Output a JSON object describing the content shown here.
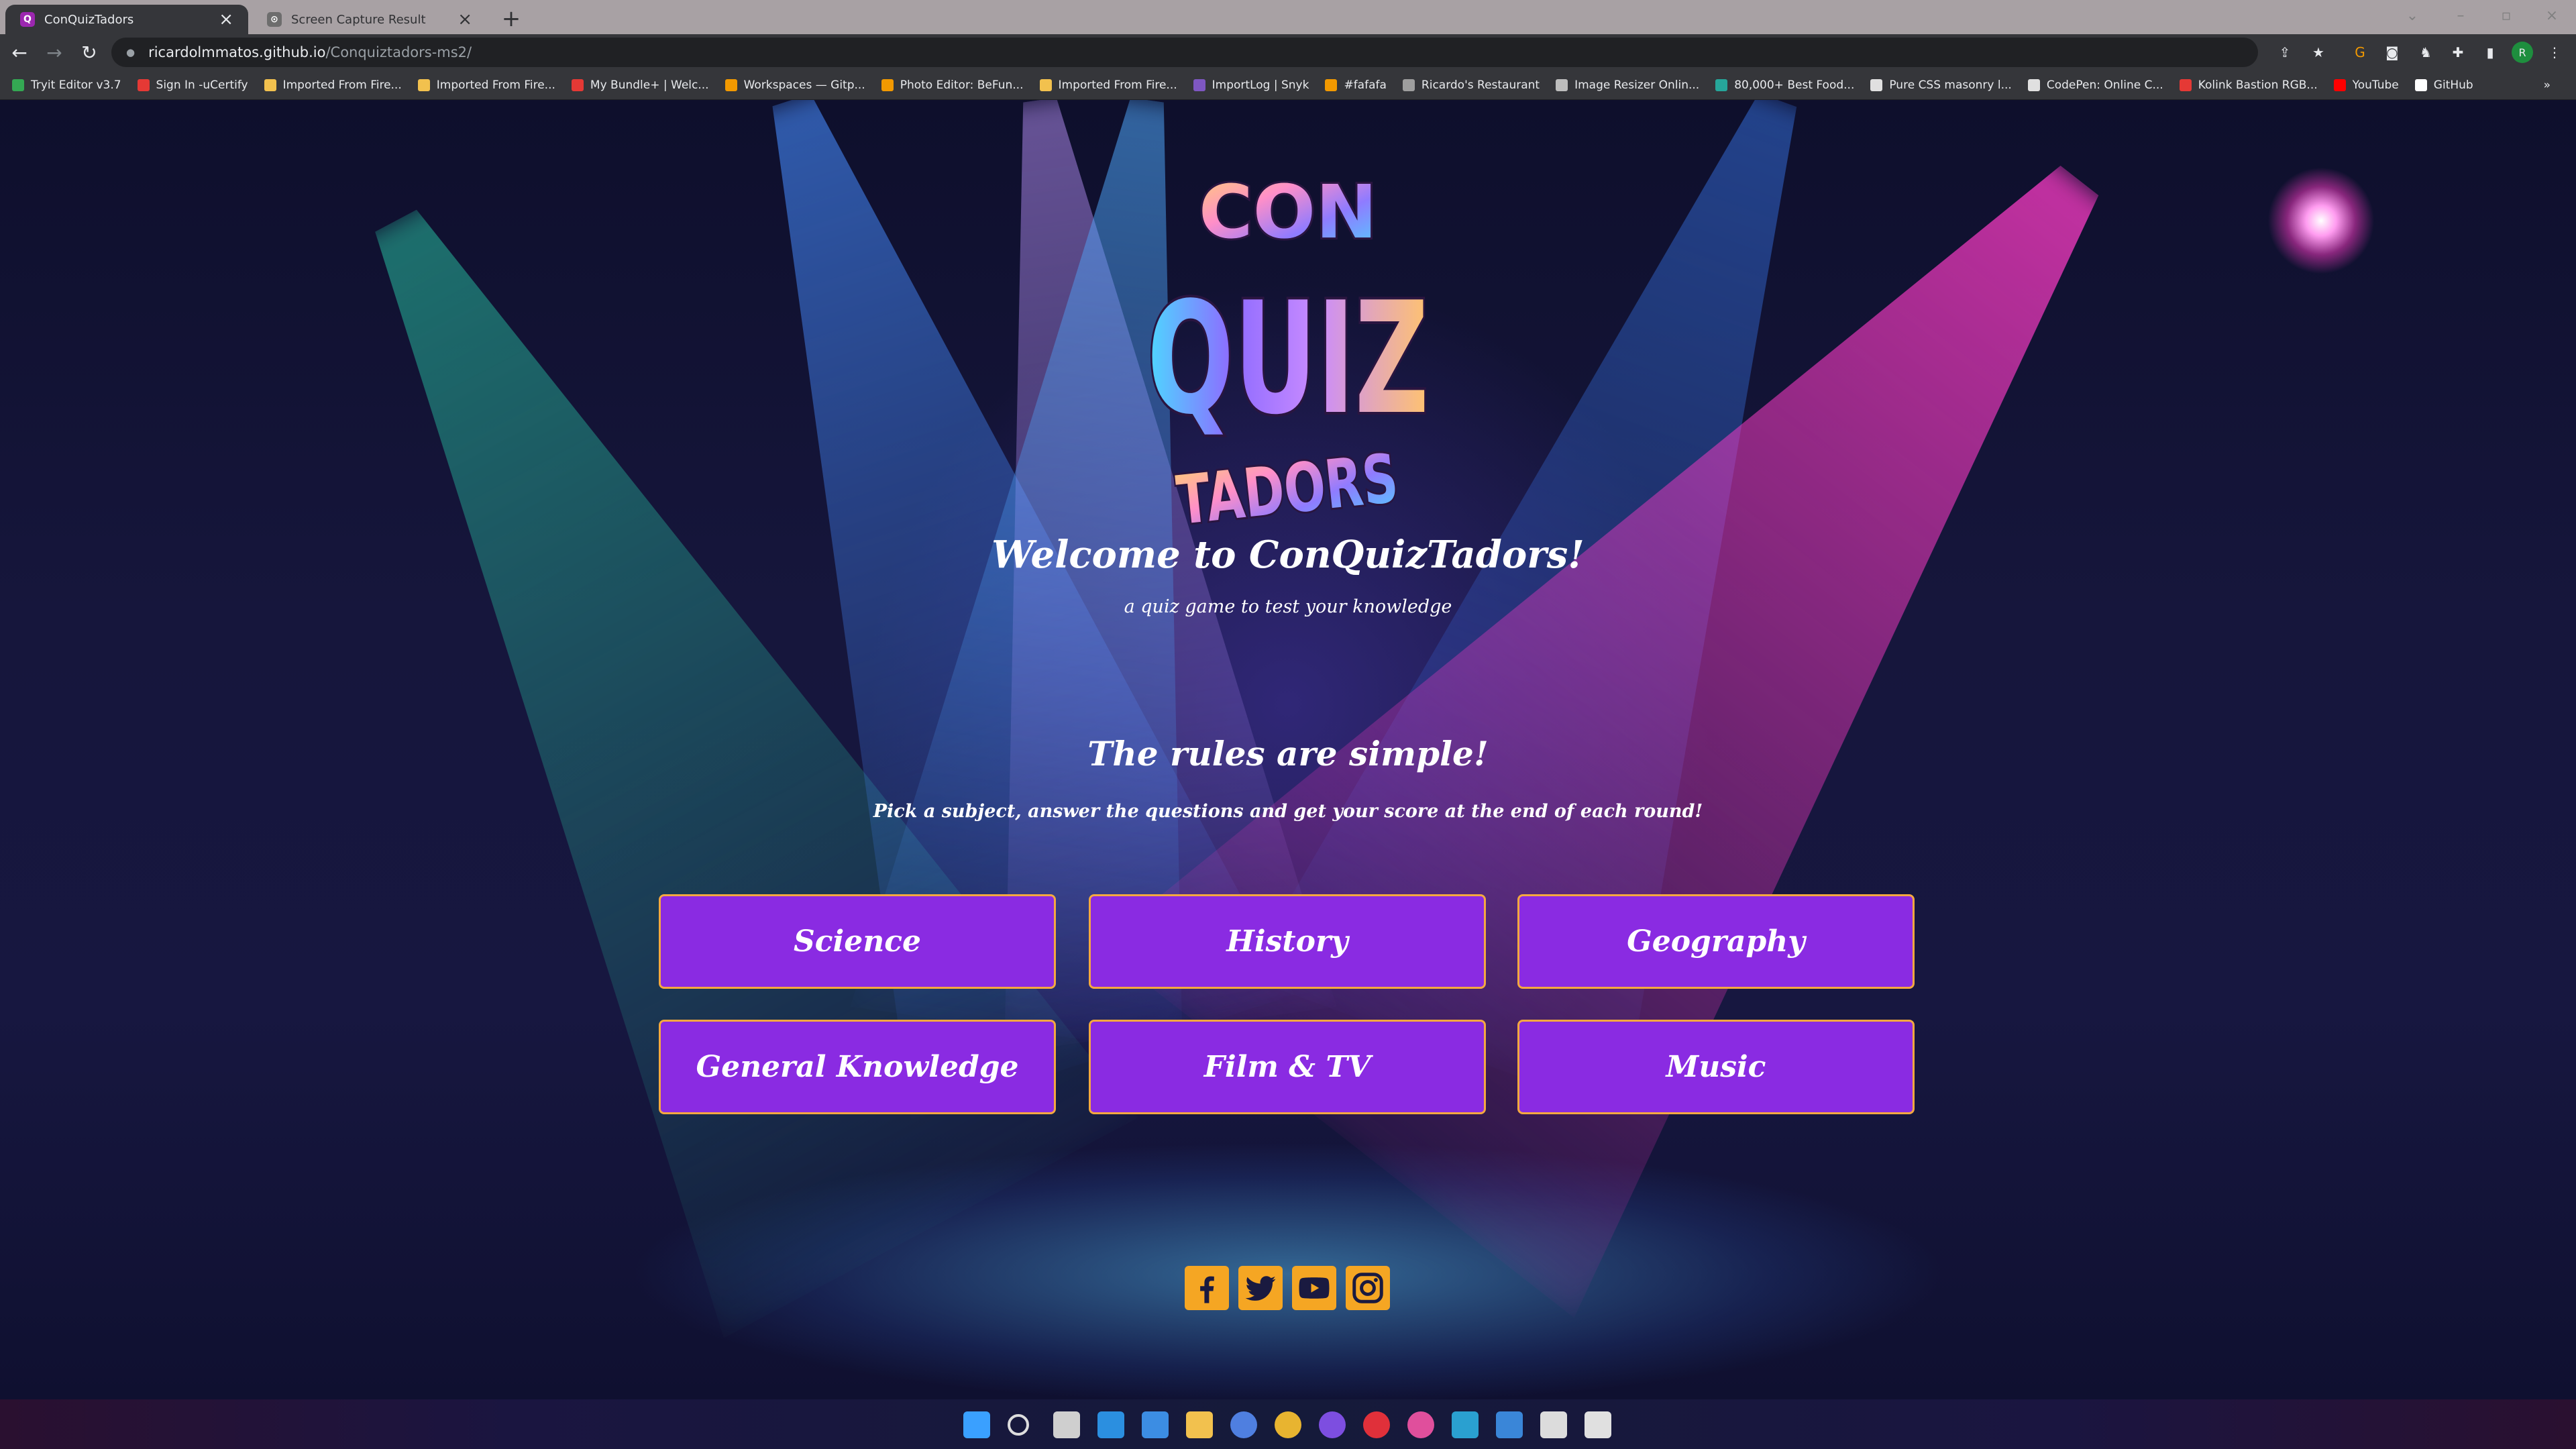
{
  "browser": {
    "tabs": [
      {
        "title": "ConQuizTadors",
        "favicon": "Q"
      },
      {
        "title": "Screen Capture Result",
        "favicon": "⊙"
      }
    ],
    "url_host": "ricardolmmatos.github.io",
    "url_path": "/Conquiztadors-ms2/",
    "profile_initial": "R",
    "bookmarks": [
      "Tryit Editor v3.7",
      "Sign In -uCertify",
      "Imported From Fire...",
      "Imported From Fire...",
      "My Bundle+ | Welc...",
      "Workspaces — Gitp...",
      "Photo Editor: BeFun...",
      "Imported From Fire...",
      "ImportLog | Snyk",
      "#fafafa",
      "Ricardo's Restaurant",
      "Image Resizer Onlin...",
      "80,000+ Best Food...",
      "Pure CSS masonry l...",
      "CodePen: Online C...",
      "Kolink Bastion RGB...",
      "YouTube",
      "GitHub"
    ]
  },
  "logo": {
    "top": "CON",
    "middle": "QUIZ",
    "bottom": "TADORS"
  },
  "hero": {
    "title": "Welcome to ConQuizTadors!",
    "subtitle": "a quiz game to test your knowledge"
  },
  "rules": {
    "title": "The rules are simple!",
    "description": "Pick a subject, answer the questions and get your score at the end of each round!"
  },
  "subjects": [
    "Science",
    "History",
    "Geography",
    "General Knowledge",
    "Film & TV",
    "Music"
  ],
  "social": [
    "facebook-icon",
    "twitter-icon",
    "youtube-icon",
    "instagram-icon"
  ],
  "colors": {
    "button": "#8a2be2",
    "button_border": "#f5a840",
    "social": "#f5a623"
  }
}
